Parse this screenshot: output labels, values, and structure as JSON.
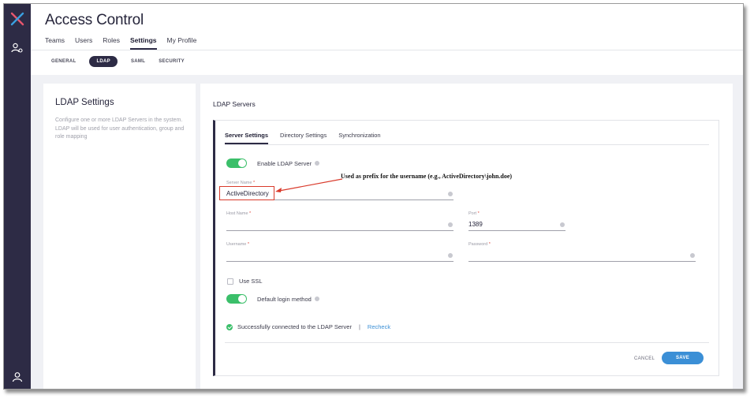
{
  "app": {
    "title": "Access Control",
    "accent_color": "#2d2b45",
    "success_color": "#3bbf6a",
    "link_color": "#3b8fd6",
    "icons": [
      "x-logo-icon",
      "users-icon",
      "account-icon"
    ]
  },
  "tabs": [
    "Teams",
    "Users",
    "Roles",
    "Settings",
    "My Profile"
  ],
  "active_tab": "Settings",
  "subtabs": [
    "GENERAL",
    "LDAP",
    "SAML",
    "SECURITY"
  ],
  "active_subtab": "LDAP",
  "left_panel": {
    "title": "LDAP Settings",
    "description": "Configure one or more LDAP Servers in the system. LDAP will be used for user authentication, group and role mapping"
  },
  "right_panel": {
    "title": "LDAP Servers",
    "panel_tabs": [
      "Server Settings",
      "Directory Settings",
      "Synchronization"
    ],
    "active_panel_tab": "Server Settings"
  },
  "form": {
    "enable_ldap_label": "Enable LDAP Server",
    "enable_ldap_on": true,
    "server_name_label": "Server Name",
    "server_name_value": "ActiveDirectory",
    "host_name_label": "Host Name",
    "host_name_value": "",
    "port_label": "Port",
    "port_value": "1389",
    "username_label": "Username",
    "username_value": "",
    "password_label": "Password",
    "password_value": "",
    "required_mark": "*",
    "use_ssl_label": "Use SSL",
    "use_ssl_checked": false,
    "default_login_label": "Default login method",
    "default_login_on": true
  },
  "status": {
    "message": "Successfully connected to the LDAP Server",
    "separator": "|",
    "recheck_label": "Recheck"
  },
  "actions": {
    "cancel_label": "CANCEL",
    "save_label": "SAVE"
  },
  "annotation": {
    "text": "Used as prefix for the username (e.g., ActiveDirectory\\john.doe)",
    "color": "#d93a2b"
  }
}
